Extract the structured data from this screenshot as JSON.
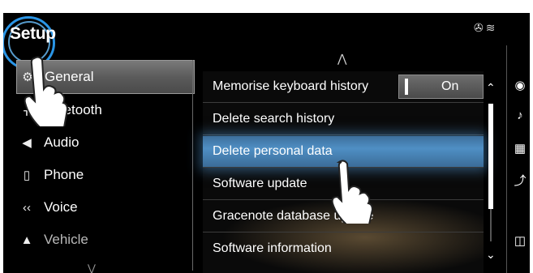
{
  "header": {
    "title": "Setup"
  },
  "status": {
    "icons": [
      "phone-off-icon",
      "wifi-icon"
    ]
  },
  "categories": [
    {
      "label": "General",
      "icon": "gear-icon",
      "glyph": "⚙"
    },
    {
      "label": "Bluetooth",
      "icon": "bluetooth-icon",
      "glyph": "ʙ"
    },
    {
      "label": "Audio",
      "icon": "speaker-icon",
      "glyph": "◂)"
    },
    {
      "label": "Phone",
      "icon": "phone-icon",
      "glyph": "▯"
    },
    {
      "label": "Voice",
      "icon": "voice-icon",
      "glyph": "«"
    },
    {
      "label": "Vehicle",
      "icon": "car-icon",
      "glyph": "⌘"
    }
  ],
  "settings": [
    {
      "label": "Memorise keyboard history",
      "value": "On"
    },
    {
      "label": "Delete search history"
    },
    {
      "label": "Delete personal data"
    },
    {
      "label": "Software update"
    },
    {
      "label": "Gracenote database update"
    },
    {
      "label": "Software information"
    }
  ],
  "side_icons": [
    "navigation-icon",
    "music-icon",
    "equalizer-icon",
    "driver-assist-icon",
    "display-icon"
  ],
  "accent": "#2a95e6",
  "highlight": "#4f8fc4"
}
